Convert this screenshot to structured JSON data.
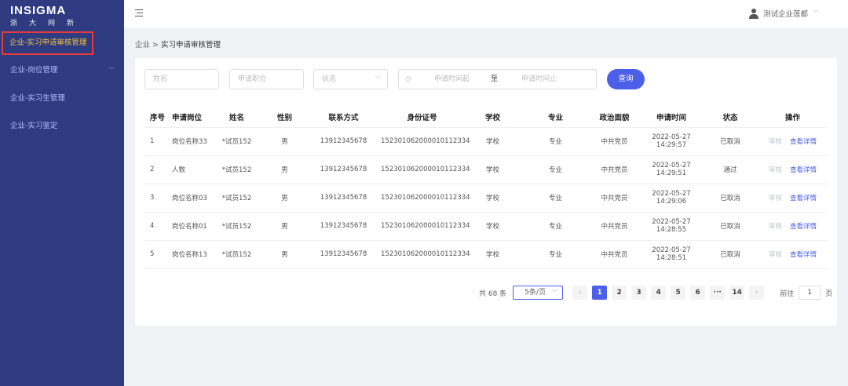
{
  "sidebar": {
    "logo_en": "INSIGMA",
    "logo_cn": "浙大网新",
    "items": [
      {
        "label": "企业-实习申请审核管理"
      },
      {
        "label": "企业-岗位管理"
      },
      {
        "label": "企业-实习生管理"
      },
      {
        "label": "企业-实习鉴定"
      }
    ]
  },
  "header": {
    "user": "测试企业莲都"
  },
  "breadcrumb": {
    "parent": "企业",
    "sep": ">",
    "current": "实习申请审核管理"
  },
  "filters": {
    "name_placeholder": "姓名",
    "position_placeholder": "申请职位",
    "status_placeholder": "状态",
    "date_start": "申请时间起",
    "date_sep": "至",
    "date_end": "申请时间止",
    "query": "查询"
  },
  "table": {
    "headers": [
      "序号",
      "申请岗位",
      "姓名",
      "性别",
      "联系方式",
      "身份证号",
      "学校",
      "专业",
      "政治面貌",
      "申请时间",
      "状态",
      "操作"
    ],
    "rows": [
      [
        "1",
        "岗位名称33",
        "*试员152",
        "男",
        "13912345678",
        "152301062000010112334",
        "学校",
        "专业",
        "中共党员",
        "2022-05-27 14:29:57",
        "已取消"
      ],
      [
        "2",
        "人数",
        "*试员152",
        "男",
        "13912345678",
        "152301062000010112334",
        "学校",
        "专业",
        "中共党员",
        "2022-05-27 14:29:51",
        "通过"
      ],
      [
        "3",
        "岗位名称03",
        "*试员152",
        "男",
        "13912345678",
        "152301062000010112334",
        "学校",
        "专业",
        "中共党员",
        "2022-05-27 14:29:06",
        "已取消"
      ],
      [
        "4",
        "岗位名称01",
        "*试员152",
        "男",
        "13912345678",
        "152301062000010112334",
        "学校",
        "专业",
        "中共党员",
        "2022-05-27 14:28:55",
        "已取消"
      ],
      [
        "5",
        "岗位名称13",
        "*试员152",
        "男",
        "13912345678",
        "152301062000010112334",
        "学校",
        "专业",
        "中共党员",
        "2022-05-27 14:28:51",
        "已取消"
      ]
    ],
    "action_review": "审核",
    "action_detail": "查看详情"
  },
  "pagination": {
    "total": "共 68 条",
    "page_size": "5条/页",
    "pages": [
      "1",
      "2",
      "3",
      "4",
      "5",
      "6",
      "···",
      "14"
    ],
    "current": "1",
    "goto_label": "前往",
    "goto_value": "1",
    "page_suffix": "页"
  }
}
